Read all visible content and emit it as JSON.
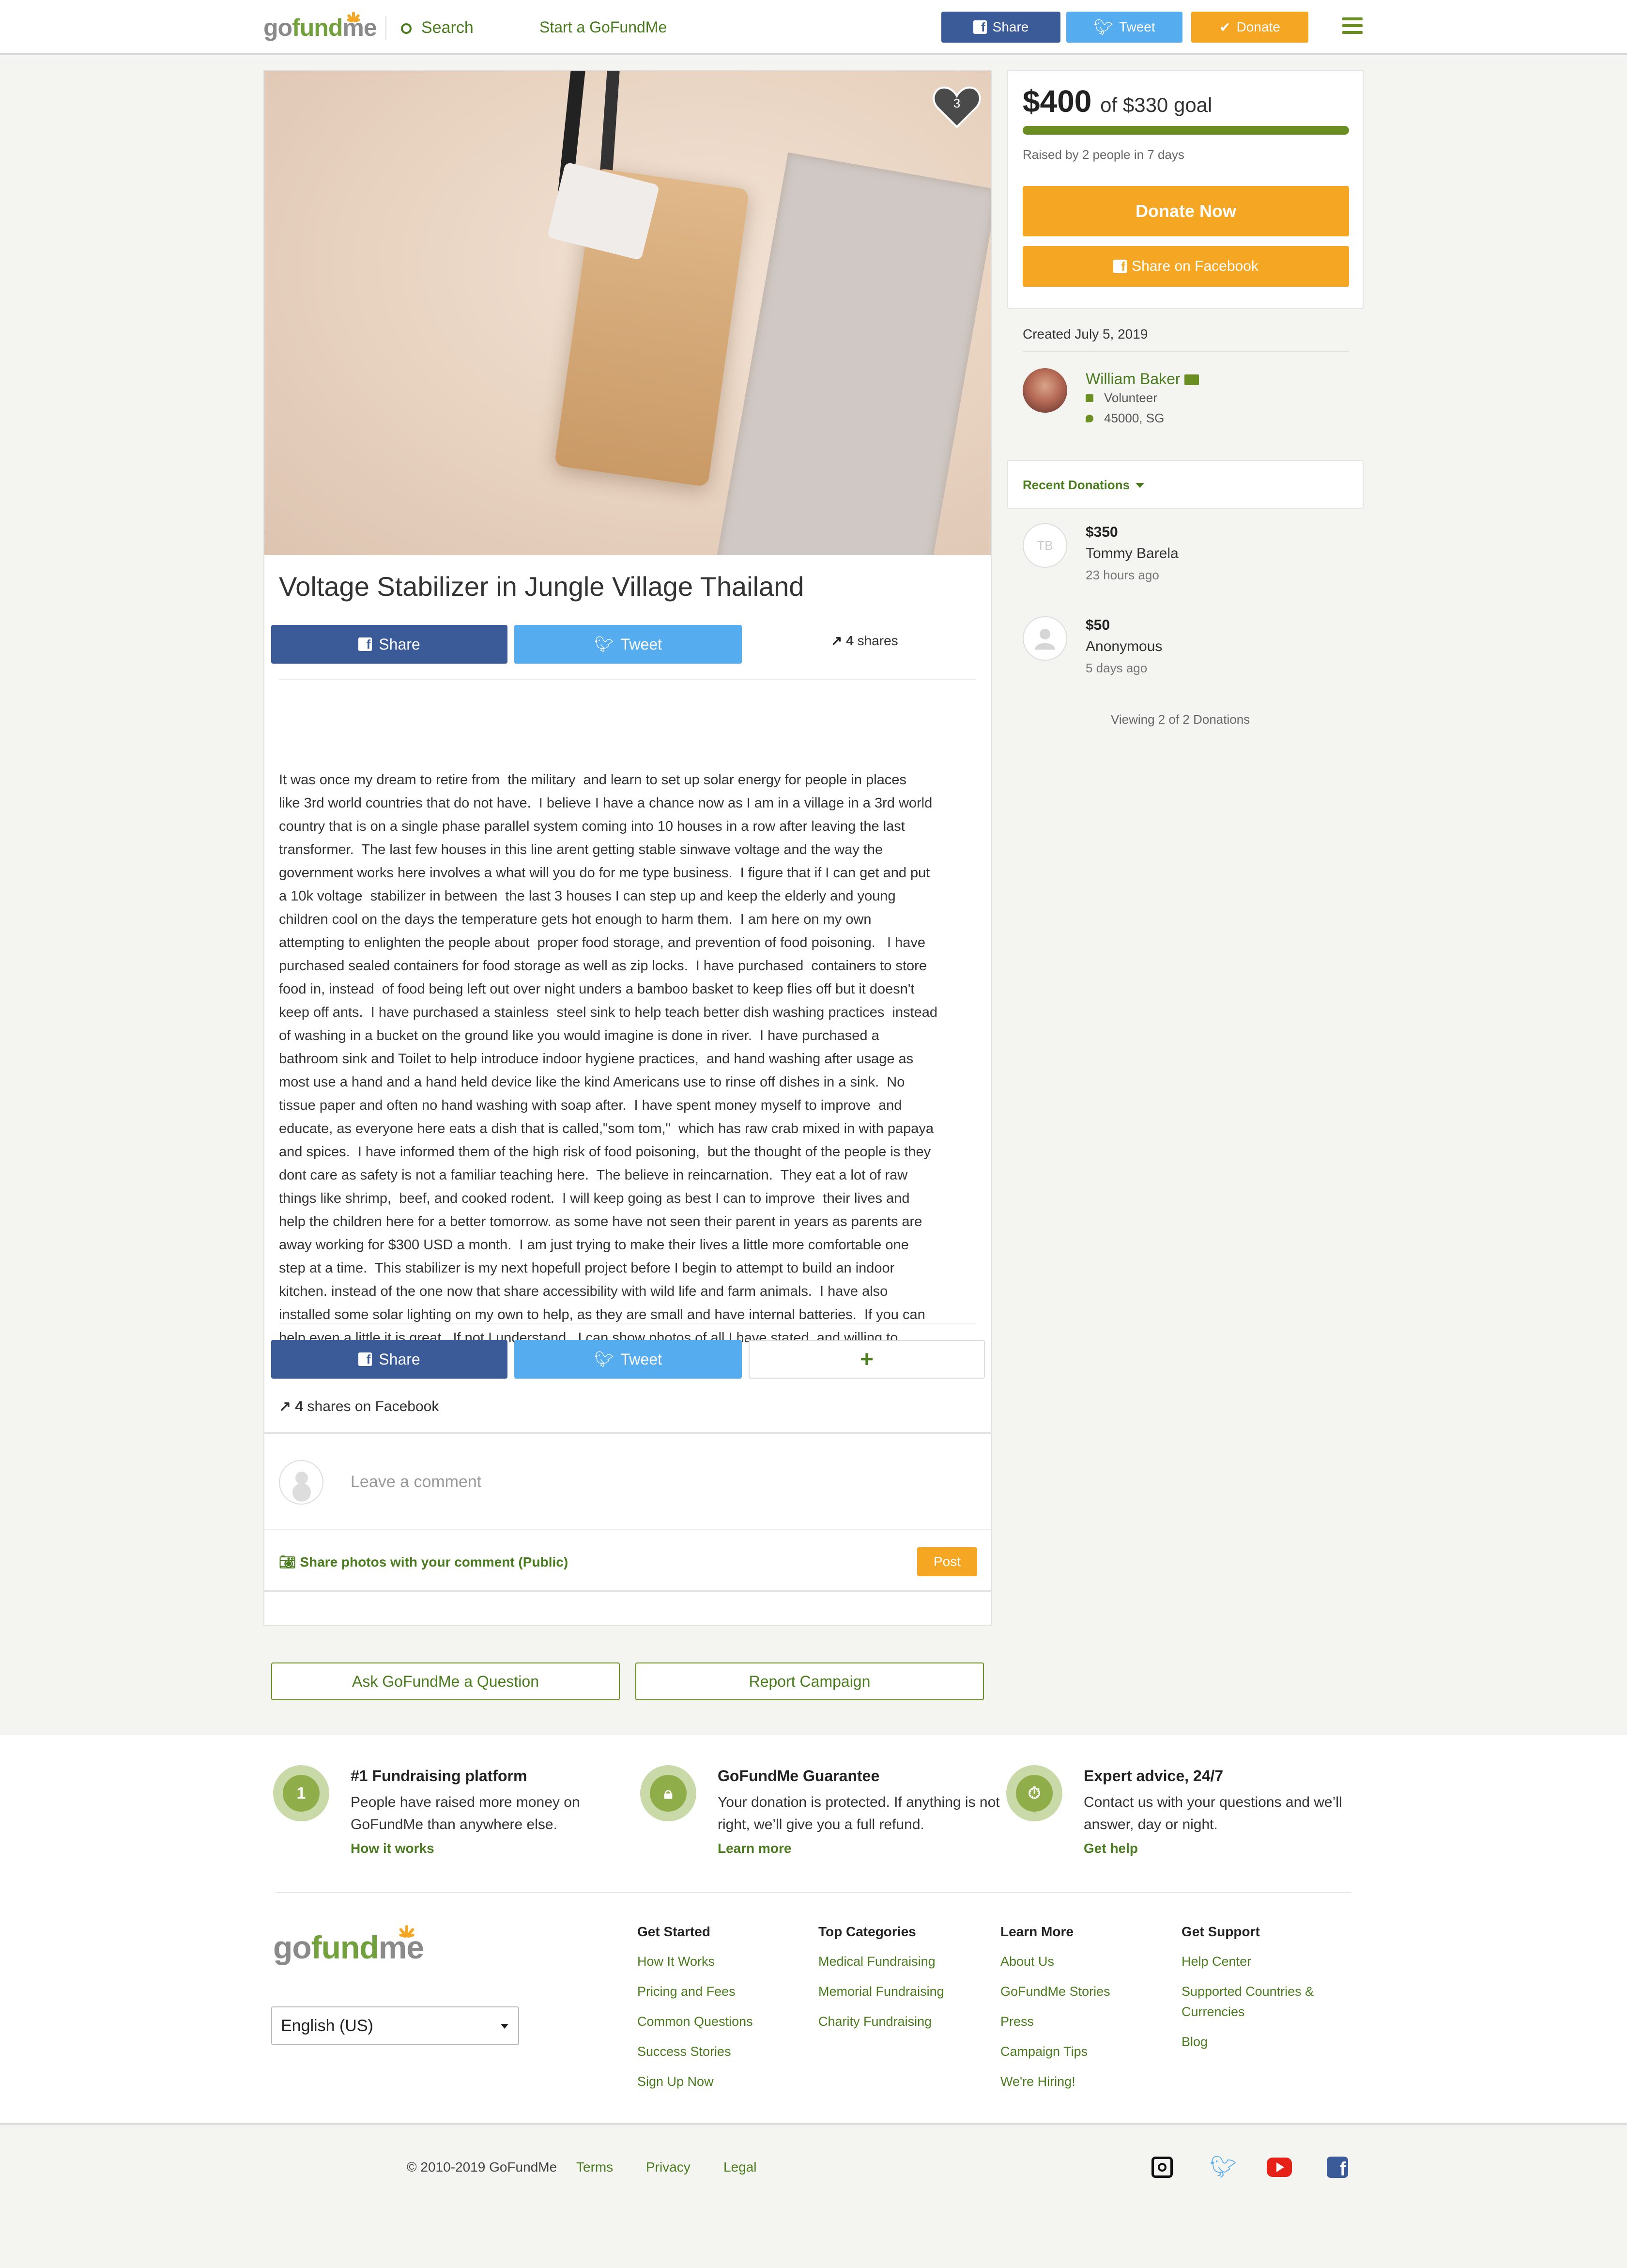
{
  "header": {
    "logo": {
      "go": "go",
      "fund": "fund",
      "me": "me"
    },
    "search_label": "Search",
    "start_label": "Start a GoFundMe",
    "share_label": "Share",
    "tweet_label": "Tweet",
    "donate_label": "Donate"
  },
  "campaign": {
    "heart_count": "3",
    "title": "Voltage Stabilizer in Jungle Village Thailand",
    "share_label": "Share",
    "tweet_label": "Tweet",
    "shares_count": "4",
    "shares_word": "shares",
    "story": "It was once my dream to retire from  the military  and learn to set up solar energy for people in places\nlike 3rd world countries that do not have.  I believe I have a chance now as I am in a village in a 3rd world\ncountry that is on a single phase parallel system coming into 10 houses in a row after leaving the last\ntransformer.  The last few houses in this line arent getting stable sinwave voltage and the way the\ngovernment works here involves a what will you do for me type business.  I figure that if I can get and put\na 10k voltage  stabilizer in between  the last 3 houses I can step up and keep the elderly and young\nchildren cool on the days the temperature gets hot enough to harm them.  I am here on my own\nattempting to enlighten the people about  proper food storage, and prevention of food poisoning.   I have\npurchased sealed containers for food storage as well as zip locks.  I have purchased  containers to store\nfood in, instead  of food being left out over night unders a bamboo basket to keep flies off but it doesn't\nkeep off ants.  I have purchased a stainless  steel sink to help teach better dish washing practices  instead\nof washing in a bucket on the ground like you would imagine is done in river.  I have purchased a\nbathroom sink and Toilet to help introduce indoor hygiene practices,  and hand washing after usage as\nmost use a hand and a hand held device like the kind Americans use to rinse off dishes in a sink.  No\ntissue paper and often no hand washing with soap after.  I have spent money myself to improve  and\neducate, as everyone here eats a dish that is called,\"som tom,\"  which has raw crab mixed in with papaya\nand spices.  I have informed them of the high risk of food poisoning,  but the thought of the people is they\ndont care as safety is not a familiar teaching here.  The believe in reincarnation.  They eat a lot of raw\nthings like shrimp,  beef, and cooked rodent.  I will keep going as best I can to improve  their lives and\nhelp the children here for a better tomorrow. as some have not seen their parent in years as parents are\naway working for $300 USD a month.  I am just trying to make their lives a little more comfortable one\nstep at a time.  This stabilizer is my next hopefull project before I begin to attempt to build an indoor\nkitchen. instead of the one now that share accessibility with wild life and farm animals.  I have also\ninstalled some solar lighting on my own to help, as they are small and have internal batteries.  If you can\nhelp even a little it is great.  If not I understand.  I can show photos of all I have stated, and willing to\nshare after photos.  Thanks.",
    "plus_label": "+",
    "shares_fb_count": "4",
    "shares_fb_text": "shares on Facebook",
    "comment_placeholder": "Leave a comment",
    "share_photos_label": "Share photos with your comment (Public)",
    "post_label": "Post",
    "ask_label": "Ask GoFundMe a Question",
    "report_label": "Report Campaign"
  },
  "sidebar": {
    "raised_amount": "$400",
    "goal_text": "of $330 goal",
    "progress_fraction": 1.0,
    "raised_text": "Raised by 2 people in 7 days",
    "donate_now_label": "Donate Now",
    "share_fb_label": "Share on Facebook",
    "created_text": "Created July 5, 2019",
    "organizer": {
      "name": "William Baker",
      "role": "Volunteer",
      "location": "45000, SG"
    },
    "recent_label": "Recent Donations",
    "donations": [
      {
        "initials": "TB",
        "amount": "$350",
        "name": "Tommy Barela",
        "time": "23 hours ago"
      },
      {
        "initials": "",
        "amount": "$50",
        "name": "Anonymous",
        "time": "5 days ago"
      }
    ],
    "viewing_text": "Viewing 2 of 2 Donations"
  },
  "features": [
    {
      "icon": "trophy-icon",
      "badge": "1",
      "title": "#1 Fundraising platform",
      "text": "People have raised more money on GoFundMe than anywhere else.",
      "link": "How it works"
    },
    {
      "icon": "lock-badge-icon",
      "badge": "",
      "title": "GoFundMe Guarantee",
      "text": "Your donation is protected. If anything is not right, we’ll give you a full refund.",
      "link": "Learn more"
    },
    {
      "icon": "stopwatch-icon",
      "badge": "",
      "title": "Expert advice, 24/7",
      "text": "Contact us with your questions and we’ll answer, day or night.",
      "link": "Get help"
    }
  ],
  "footer": {
    "language": "English (US)",
    "columns": [
      {
        "title": "Get Started",
        "links": [
          "How It Works",
          "Pricing and Fees",
          "Common Questions",
          "Success Stories",
          "Sign Up Now"
        ]
      },
      {
        "title": "Top Categories",
        "links": [
          "Medical Fundraising",
          "Memorial Fundraising",
          "Charity Fundraising"
        ]
      },
      {
        "title": "Learn More",
        "links": [
          "About Us",
          "GoFundMe Stories",
          "Press",
          "Campaign Tips",
          "We're Hiring!"
        ]
      },
      {
        "title": "Get Support",
        "links": [
          "Help Center",
          "Supported Countries &",
          "Currencies",
          "Blog"
        ]
      }
    ],
    "copyright": "© 2010-2019 GoFundMe",
    "bottom_links": [
      "Terms",
      "Privacy",
      "Legal"
    ],
    "social": [
      "instagram-icon",
      "twitter-icon",
      "youtube-icon",
      "facebook-icon"
    ]
  },
  "colors": {
    "brand_green": "#4a7c1f",
    "accent_orange": "#f5a623",
    "facebook_blue": "#3a5a98",
    "twitter_blue": "#55acee"
  }
}
